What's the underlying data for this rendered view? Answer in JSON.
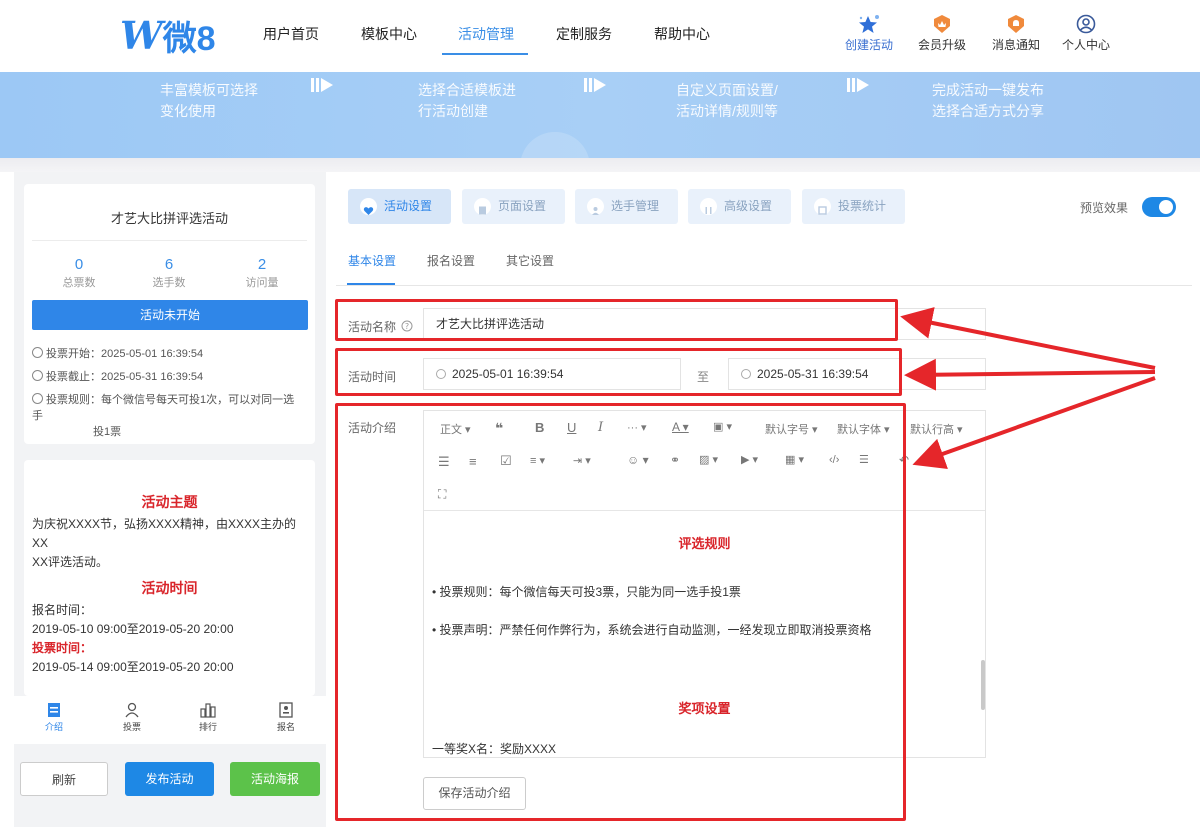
{
  "header": {
    "logo_mark": "W",
    "logo_name": "微8",
    "nav": [
      {
        "label": "用户首页"
      },
      {
        "label": "模板中心"
      },
      {
        "label": "活动管理",
        "active": true
      },
      {
        "label": "定制服务"
      },
      {
        "label": "帮助中心"
      }
    ],
    "actions": [
      {
        "label": "创建活动",
        "icon": "star-sparkle-icon"
      },
      {
        "label": "会员升级",
        "icon": "crown-badge-icon"
      },
      {
        "label": "消息通知",
        "icon": "bell-badge-icon"
      },
      {
        "label": "个人中心",
        "icon": "user-circle-icon"
      }
    ],
    "accent_color": "#3a8ee6"
  },
  "banner": {
    "steps": [
      {
        "line1": "丰富模板可选择",
        "line2": "变化使用"
      },
      {
        "line1": "选择合适模板进",
        "line2": "行活动创建"
      },
      {
        "line1": "自定义页面设置/",
        "line2": "活动详情/规则等"
      },
      {
        "line1": "完成活动一键发布",
        "line2": "选择合适方式分享"
      }
    ]
  },
  "left_panel": {
    "activity_title": "才艺大比拼评选活动",
    "stats": [
      {
        "value": "0",
        "label": "总票数"
      },
      {
        "value": "6",
        "label": "选手数"
      },
      {
        "value": "2",
        "label": "访问量"
      }
    ],
    "status_button": "活动未开始",
    "vote_start": "投票开始：2025-05-01 16:39:54",
    "vote_end": "投票截止：2025-05-31 16:39:54",
    "vote_rule_line1": "投票规则：每个微信号每天可投1次，可以对同一选手",
    "vote_rule_line2": "投1票",
    "content": {
      "theme_heading": "活动主题",
      "theme_text_line1": "为庆祝XXXX节，弘扬XXXX精神，由XXXX主办的XX",
      "theme_text_line2": "XX评选活动。",
      "time_heading": "活动时间",
      "signup_label": "报名时间：",
      "signup_range": "2019-05-10 09:00至2019-05-20 20:00",
      "vote_label": "投票时间：",
      "vote_range": "2019-05-14 09:00至2019-05-20 20:00"
    },
    "bottom_tabs": [
      {
        "label": "介绍",
        "icon": "intro-doc-icon",
        "active": true
      },
      {
        "label": "投票",
        "icon": "vote-user-icon"
      },
      {
        "label": "排行",
        "icon": "ranking-bars-icon"
      },
      {
        "label": "报名",
        "icon": "signup-card-icon"
      }
    ],
    "buttons": {
      "refresh": "刷新",
      "publish": "发布活动",
      "poster": "活动海报"
    }
  },
  "main": {
    "step_tabs": [
      {
        "label": "活动设置",
        "active": true
      },
      {
        "label": "页面设置"
      },
      {
        "label": "选手管理"
      },
      {
        "label": "高级设置"
      },
      {
        "label": "投票统计"
      }
    ],
    "preview_label": "预览效果",
    "preview_on": true,
    "sub_tabs": [
      {
        "label": "基本设置",
        "active": true
      },
      {
        "label": "报名设置"
      },
      {
        "label": "其它设置"
      }
    ],
    "name_label": "活动名称",
    "name_value": "才艺大比拼评选活动",
    "time_label": "活动时间",
    "time_start": "2025-05-01 16:39:54",
    "time_to": "至",
    "time_end": "2025-05-31 16:39:54",
    "intro_label": "活动介绍",
    "toolbar": {
      "paragraph": "正文",
      "font_size": "默认字号",
      "font_family": "默认字体",
      "line_height": "默认行高"
    },
    "editor": {
      "rules_heading": "评选规则",
      "rule1": "• 投票规则：每个微信每天可投3票，只能为同一选手投1票",
      "rule2": "• 投票声明：严禁任何作弊行为，系统会进行自动监测，一经发现立即取消投票资格",
      "prize_heading": "奖项设置",
      "prize1": "一等奖X名：奖励XXXX"
    },
    "save_intro_button": "保存活动介绍"
  }
}
